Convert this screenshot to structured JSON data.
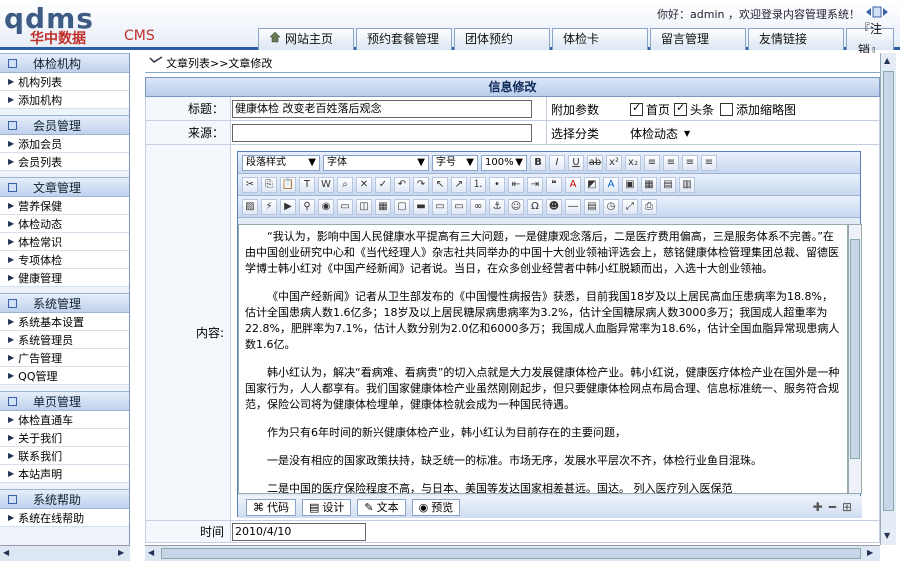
{
  "header": {
    "logo_text": "qdms",
    "logo_cn": "华中数据",
    "logo_cms": "CMS",
    "welcome": "你好：admin ，欢迎登录内容管理系统！"
  },
  "tabs": [
    {
      "label": "网站主页",
      "icon": "home-icon"
    },
    {
      "label": "预约套餐管理"
    },
    {
      "label": "团体预约"
    },
    {
      "label": "体检卡"
    },
    {
      "label": "留言管理"
    },
    {
      "label": "友情链接"
    },
    {
      "label": "『注销』"
    }
  ],
  "sidebar": {
    "sections": [
      {
        "title": "体检机构",
        "items": [
          "机构列表",
          "添加机构"
        ]
      },
      {
        "title": "会员管理",
        "items": [
          "添加会员",
          "会员列表"
        ]
      },
      {
        "title": "文章管理",
        "items": [
          "营养保健",
          "体检动态",
          "体检常识",
          "专项体检",
          "健康管理"
        ]
      },
      {
        "title": "系统管理",
        "items": [
          "系统基本设置",
          "系统管理员",
          "广告管理",
          "QQ管理"
        ]
      },
      {
        "title": "单页管理",
        "items": [
          "体检直通车",
          "关于我们",
          "联系我们",
          "本站声明"
        ]
      },
      {
        "title": "系统帮助",
        "items": [
          "系统在线帮助"
        ]
      }
    ]
  },
  "breadcrumb": "文章列表>>文章修改",
  "form": {
    "title": "信息修改",
    "title_label": "标题：",
    "title_value": "健康体检 改变老百姓落后观念",
    "source_label": "来源：",
    "source_value": "",
    "extra_label": "附加参数",
    "cb_home": "首页",
    "cb_headline": "头条",
    "cb_thumb": "添加缩略图",
    "category_label": "选择分类",
    "category_value": "体检动态",
    "content_label": "内容:",
    "time_label": "时间",
    "time_value": "2010/4/10"
  },
  "editor": {
    "style_dd": "段落样式",
    "font_dd": "字体",
    "size_dd": "字号",
    "zoom_dd": "100%",
    "modes": [
      "代码",
      "设计",
      "文本",
      "预览"
    ],
    "paragraphs": [
      "“我认为，影响中国人民健康水平提高有三大问题，一是健康观念落后，二是医疗费用偏高，三是服务体系不完善。”在由中国创业研究中心和《当代经理人》杂志社共同举办的中国十大创业领袖评选会上，慈铭健康体检管理集团总裁、留德医学博士韩小红对《中国产经新闻》记者说。当日，在众多创业经营者中韩小红脱颖而出，入选十大创业领袖。",
      "《中国产经新闻》记者从卫生部发布的《中国慢性病报告》获悉，目前我国18岁及以上居民高血压患病率为18.8%，估计全国患病人数1.6亿多；18岁及以上居民糖尿病患病率为3.2%，估计全国糖尿病人数3000多万；我国成人超重率为22.8%，肥胖率为7.1%，估计人数分别为2.0亿和6000多万；我国成人血脂异常率为18.6%，估计全国血脂异常现患病人数1.6亿。",
      "韩小红认为，解决“看病难、看病贵”的切入点就是大力发展健康体检产业。韩小红说，健康医疗体检产业在国外是一种国家行为，人人都享有。我们国家健康体检产业虽然刚刚起步，但只要健康体检网点布局合理、信息标准统一、服务符合规范，保险公司将为健康体检埋单，健康体检就会成为一种国民待遇。",
      "作为只有6年时间的新兴健康体检产业，韩小红认为目前存在的主要问题，",
      "一是没有相应的国家政策扶持，缺乏统一的标准。市场无序，发展水平层次不齐，体检行业鱼目混珠。",
      "二是中国的医疗保险程度不高，与日本、美国等发达国家相差甚远。国达。                     列入医疗列入医保范"
    ]
  }
}
